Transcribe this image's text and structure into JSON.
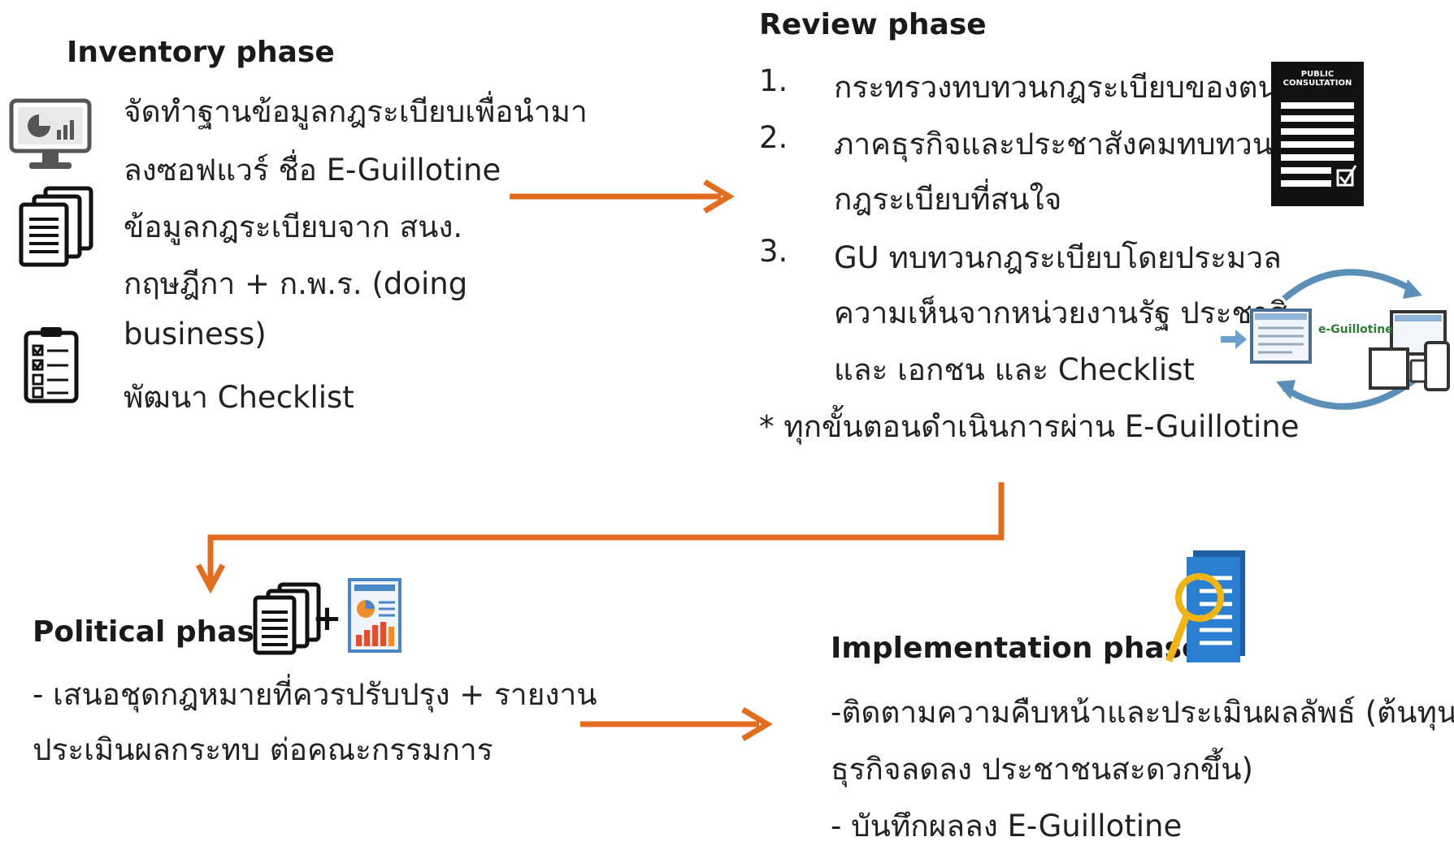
{
  "colors": {
    "arrow": "#e36c1f",
    "doc_blue": "#2b7fd0",
    "magnifier": "#f2b411",
    "dark": "#1a1a1a"
  },
  "inventory": {
    "title": "Inventory phase",
    "lines": [
      "จัดทำฐานข้อมูลกฎระเบียบเพื่อนำมา",
      "ลงซอฟแวร์ ชื่อ E-Guillotine",
      "ข้อมูลกฎระเบียบจาก สนง.",
      "กฤษฎีกา + ก.พ.ร. (doing",
      "business)",
      "พัฒนา Checklist"
    ],
    "icons": [
      "monitor-chart-icon",
      "documents-stack-icon",
      "checklist-icon"
    ]
  },
  "review": {
    "title": "Review phase",
    "items": [
      {
        "num": "1.",
        "lines": [
          "กระทรวงทบทวนกฎระเบียบของตน"
        ]
      },
      {
        "num": "2.",
        "lines": [
          "ภาคธุรกิจและประชาสังคมทบทวน",
          "กฎระเบียบที่สนใจ"
        ]
      },
      {
        "num": "3.",
        "lines": [
          "GU ทบทวนกฎระเบียบโดยประมวล",
          "ความเห็นจากหน่วยงานรัฐ ประชาสิ",
          "และ เอกชน และ Checklist"
        ]
      }
    ],
    "note": "* ทุกขั้นตอนดำเนินการผ่าน E-Guillotine",
    "public_consultation_label_1": "PUBLIC",
    "public_consultation_label_2": "CONSULTATION",
    "eguillotine_label": "e-Guillotine"
  },
  "political": {
    "title": "Political phase",
    "lines": [
      "- เสนอชุดกฎหมายที่ควรปรับปรุง  + รายงาน",
      "ประเมินผลกระทบ ต่อคณะกรรมการ"
    ],
    "plus": "+"
  },
  "implementation": {
    "title": "Implementation phase",
    "lines": [
      "-ติดตามความคืบหน้าและประเมินผลลัพธ์ (ต้นทุน",
      "ธุรกิจลดลง ประชาชนสะดวกขึ้น)",
      "- บันทึกผลลง E-Guillotine"
    ]
  }
}
